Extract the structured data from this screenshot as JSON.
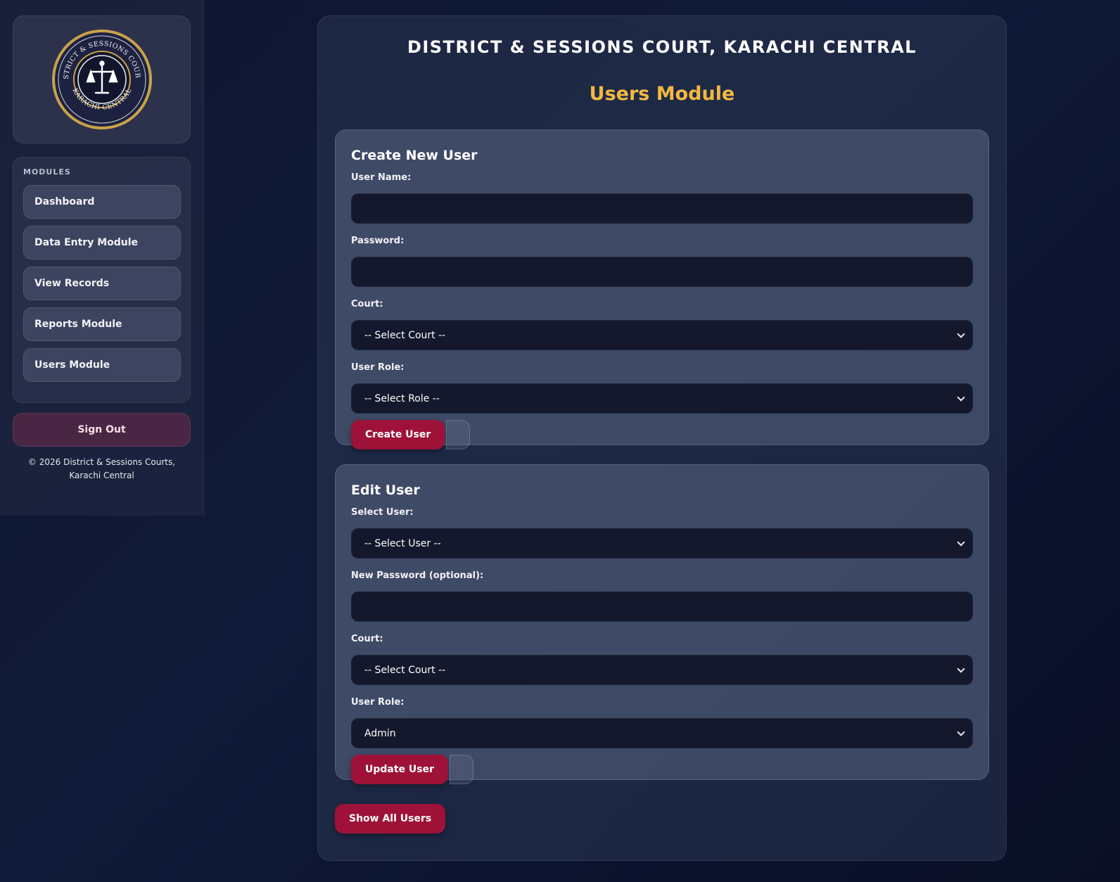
{
  "sidebar": {
    "logo": {
      "top_text": "DISTRICT & SESSIONS COURTS",
      "bottom_text": "KARACHI CENTRAL",
      "icon": "scales-of-justice-icon",
      "ring_color": "#c9a24a"
    },
    "modules_title": "MODULES",
    "items": [
      {
        "label": "Dashboard"
      },
      {
        "label": "Data Entry Module"
      },
      {
        "label": "View Records"
      },
      {
        "label": "Reports Module"
      },
      {
        "label": "Users Module"
      }
    ],
    "sign_out_label": "Sign Out",
    "copyright": "© 2026 District & Sessions Courts, Karachi Central"
  },
  "header": {
    "court_title": "DISTRICT & SESSIONS COURT, KARACHI CENTRAL",
    "module_title": "Users Module",
    "accent_color": "#f2b840"
  },
  "create_user": {
    "title": "Create New User",
    "username_label": "User Name:",
    "username_value": "",
    "password_label": "Password:",
    "password_value": "",
    "court_label": "Court:",
    "court_selected": "-- Select Court --",
    "role_label": "User Role:",
    "role_selected": "-- Select Role --",
    "submit_label": "Create User"
  },
  "edit_user": {
    "title": "Edit User",
    "select_user_label": "Select User:",
    "select_user_selected": "-- Select User --",
    "new_password_label": "New Password (optional):",
    "new_password_value": "",
    "court_label": "Court:",
    "court_selected": "-- Select Court --",
    "role_label": "User Role:",
    "role_selected": "Admin",
    "submit_label": "Update User"
  },
  "show_all_label": "Show All Users",
  "colors": {
    "button": "#9e1238",
    "input_bg": "#13182c"
  }
}
